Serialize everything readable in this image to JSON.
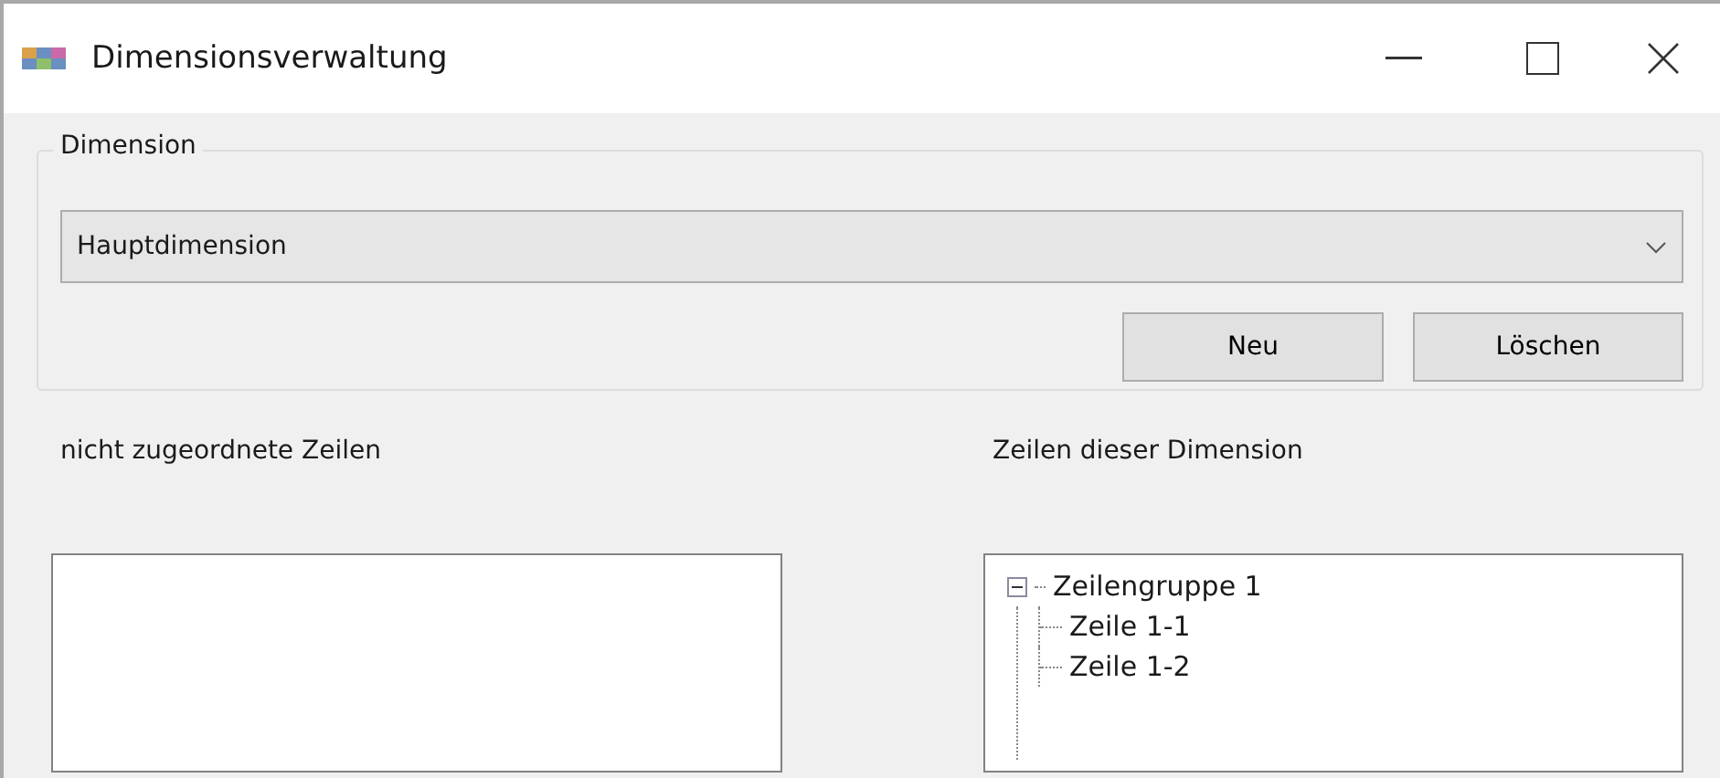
{
  "window": {
    "title": "Dimensionsverwaltung"
  },
  "dimension_group": {
    "label": "Dimension",
    "dropdown": {
      "value": "Hauptdimension"
    },
    "buttons": [
      "Neu",
      "Löschen"
    ]
  },
  "unassigned_rows": {
    "label": "nicht zugeordnete Zeilen"
  },
  "dimension_rows": {
    "label": "Zeilen dieser Dimension",
    "tree": [
      {
        "label": "Zeilengruppe 1",
        "expanded": true,
        "children": [
          {
            "label": "Zeile 1-1"
          },
          {
            "label": "Zeile 1-2"
          }
        ]
      }
    ]
  }
}
